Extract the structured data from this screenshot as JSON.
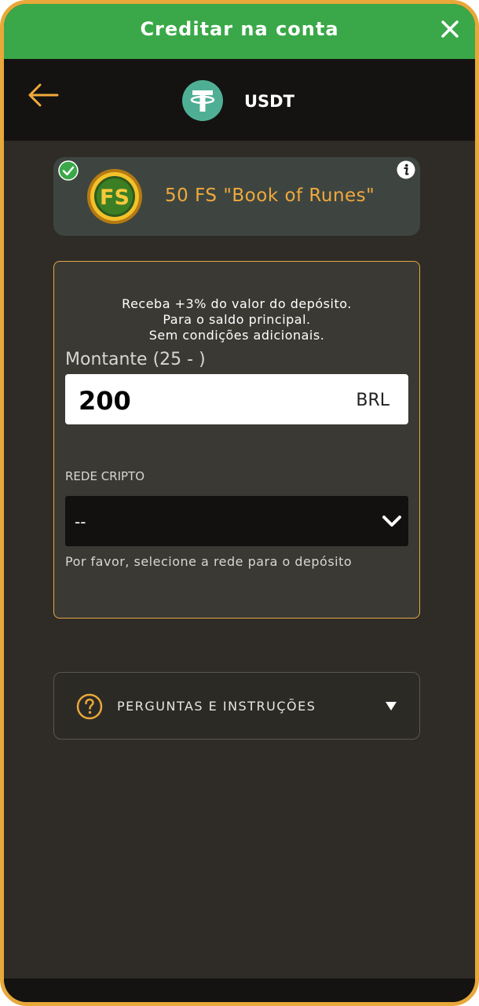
{
  "dialog": {
    "title": "Creditar na conta"
  },
  "header": {
    "currency_name": "USDT"
  },
  "promo": {
    "label": "50 FS \"Book of Runes\"",
    "badge": "FS"
  },
  "deposit": {
    "bonus_lines": [
      "Receba +3% do valor do depósito.",
      "Para o saldo principal.",
      "Sem condições adicionais."
    ],
    "amount_label": "Montante (25 - )",
    "amount_value": "200",
    "currency": "BRL",
    "network_label": "REDE CRIPTO",
    "network_value": "--",
    "network_hint": "Por favor, selecione a rede para o depósito"
  },
  "faq": {
    "label": "PERGUNTAS E INSTRUÇÕES"
  },
  "colors": {
    "accent_orange": "#e8a83a",
    "topbar_green": "#3aa848",
    "tether_green": "#4faf95",
    "promo_text": "#f0a93c"
  },
  "icons": {
    "close": "close-icon",
    "back": "back-arrow-icon",
    "coin": "tether-icon",
    "check": "check-circle-icon",
    "info": "info-icon",
    "fs_badge": "fs-coin-icon",
    "dropdown": "chevron-down-icon",
    "help": "question-circle-icon",
    "expand": "caret-down-icon"
  }
}
